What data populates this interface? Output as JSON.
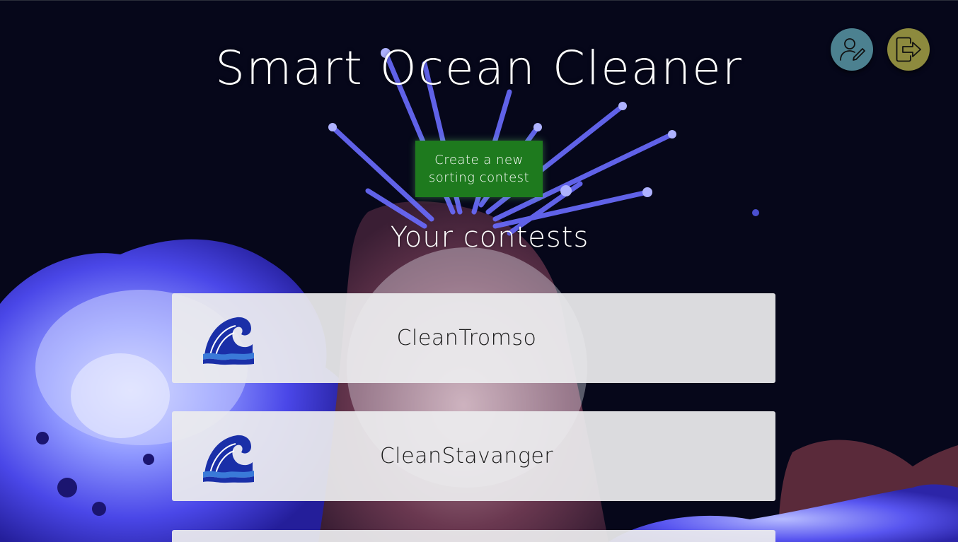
{
  "app": {
    "title": "Smart Ocean Cleaner"
  },
  "header": {
    "profile_icon": "user-edit-icon",
    "logout_icon": "logout-icon"
  },
  "actions": {
    "create_contest_line1": "Create a new",
    "create_contest_line2": "sorting contest"
  },
  "contests": {
    "heading": "Your contests",
    "logo_icon": "wave-icon",
    "items": [
      {
        "name": "CleanTromso"
      },
      {
        "name": "CleanStavanger"
      },
      {
        "name": ""
      }
    ]
  },
  "colors": {
    "background": "#06071a",
    "create_button": "#1e7a1e",
    "profile_button": "#4c8190",
    "logout_button": "#8d8a3e",
    "card": "#ececee"
  }
}
